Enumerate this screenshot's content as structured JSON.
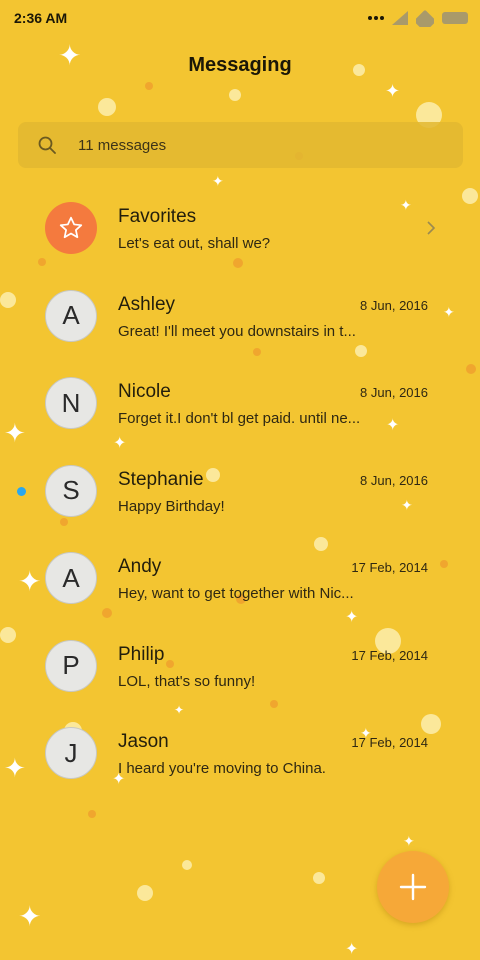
{
  "status_bar": {
    "time": "2:36 AM"
  },
  "header": {
    "title": "Messaging"
  },
  "search": {
    "text": "11 messages",
    "icon": "search-icon"
  },
  "colors": {
    "background": "#f3c531",
    "favorites_avatar": "#f47a3e",
    "fab": "#f6a838",
    "unread_dot": "#2aa7ee"
  },
  "conversations": [
    {
      "name": "Favorites",
      "preview": "Let's eat out, shall we?",
      "icon": "star-icon",
      "has_chevron": true
    },
    {
      "name": "Ashley",
      "initial": "A",
      "date": "8 Jun, 2016",
      "preview": "Great! I'll meet you downstairs in t..."
    },
    {
      "name": "Nicole",
      "initial": "N",
      "date": "8 Jun, 2016",
      "preview": "Forget it.I don't bl get paid. until ne..."
    },
    {
      "name": "Stephanie",
      "initial": "S",
      "date": "8 Jun, 2016",
      "preview": "Happy Birthday!",
      "unread": true
    },
    {
      "name": "Andy",
      "initial": "A",
      "date": "17 Feb, 2014",
      "preview": "Hey, want to get together with Nic..."
    },
    {
      "name": "Philip",
      "initial": "P",
      "date": "17 Feb, 2014",
      "preview": "LOL, that's so funny!"
    },
    {
      "name": "Jason",
      "initial": "J",
      "date": "17 Feb, 2014",
      "preview": "I heard you're moving to China."
    }
  ],
  "fab": {
    "icon": "plus-icon"
  }
}
